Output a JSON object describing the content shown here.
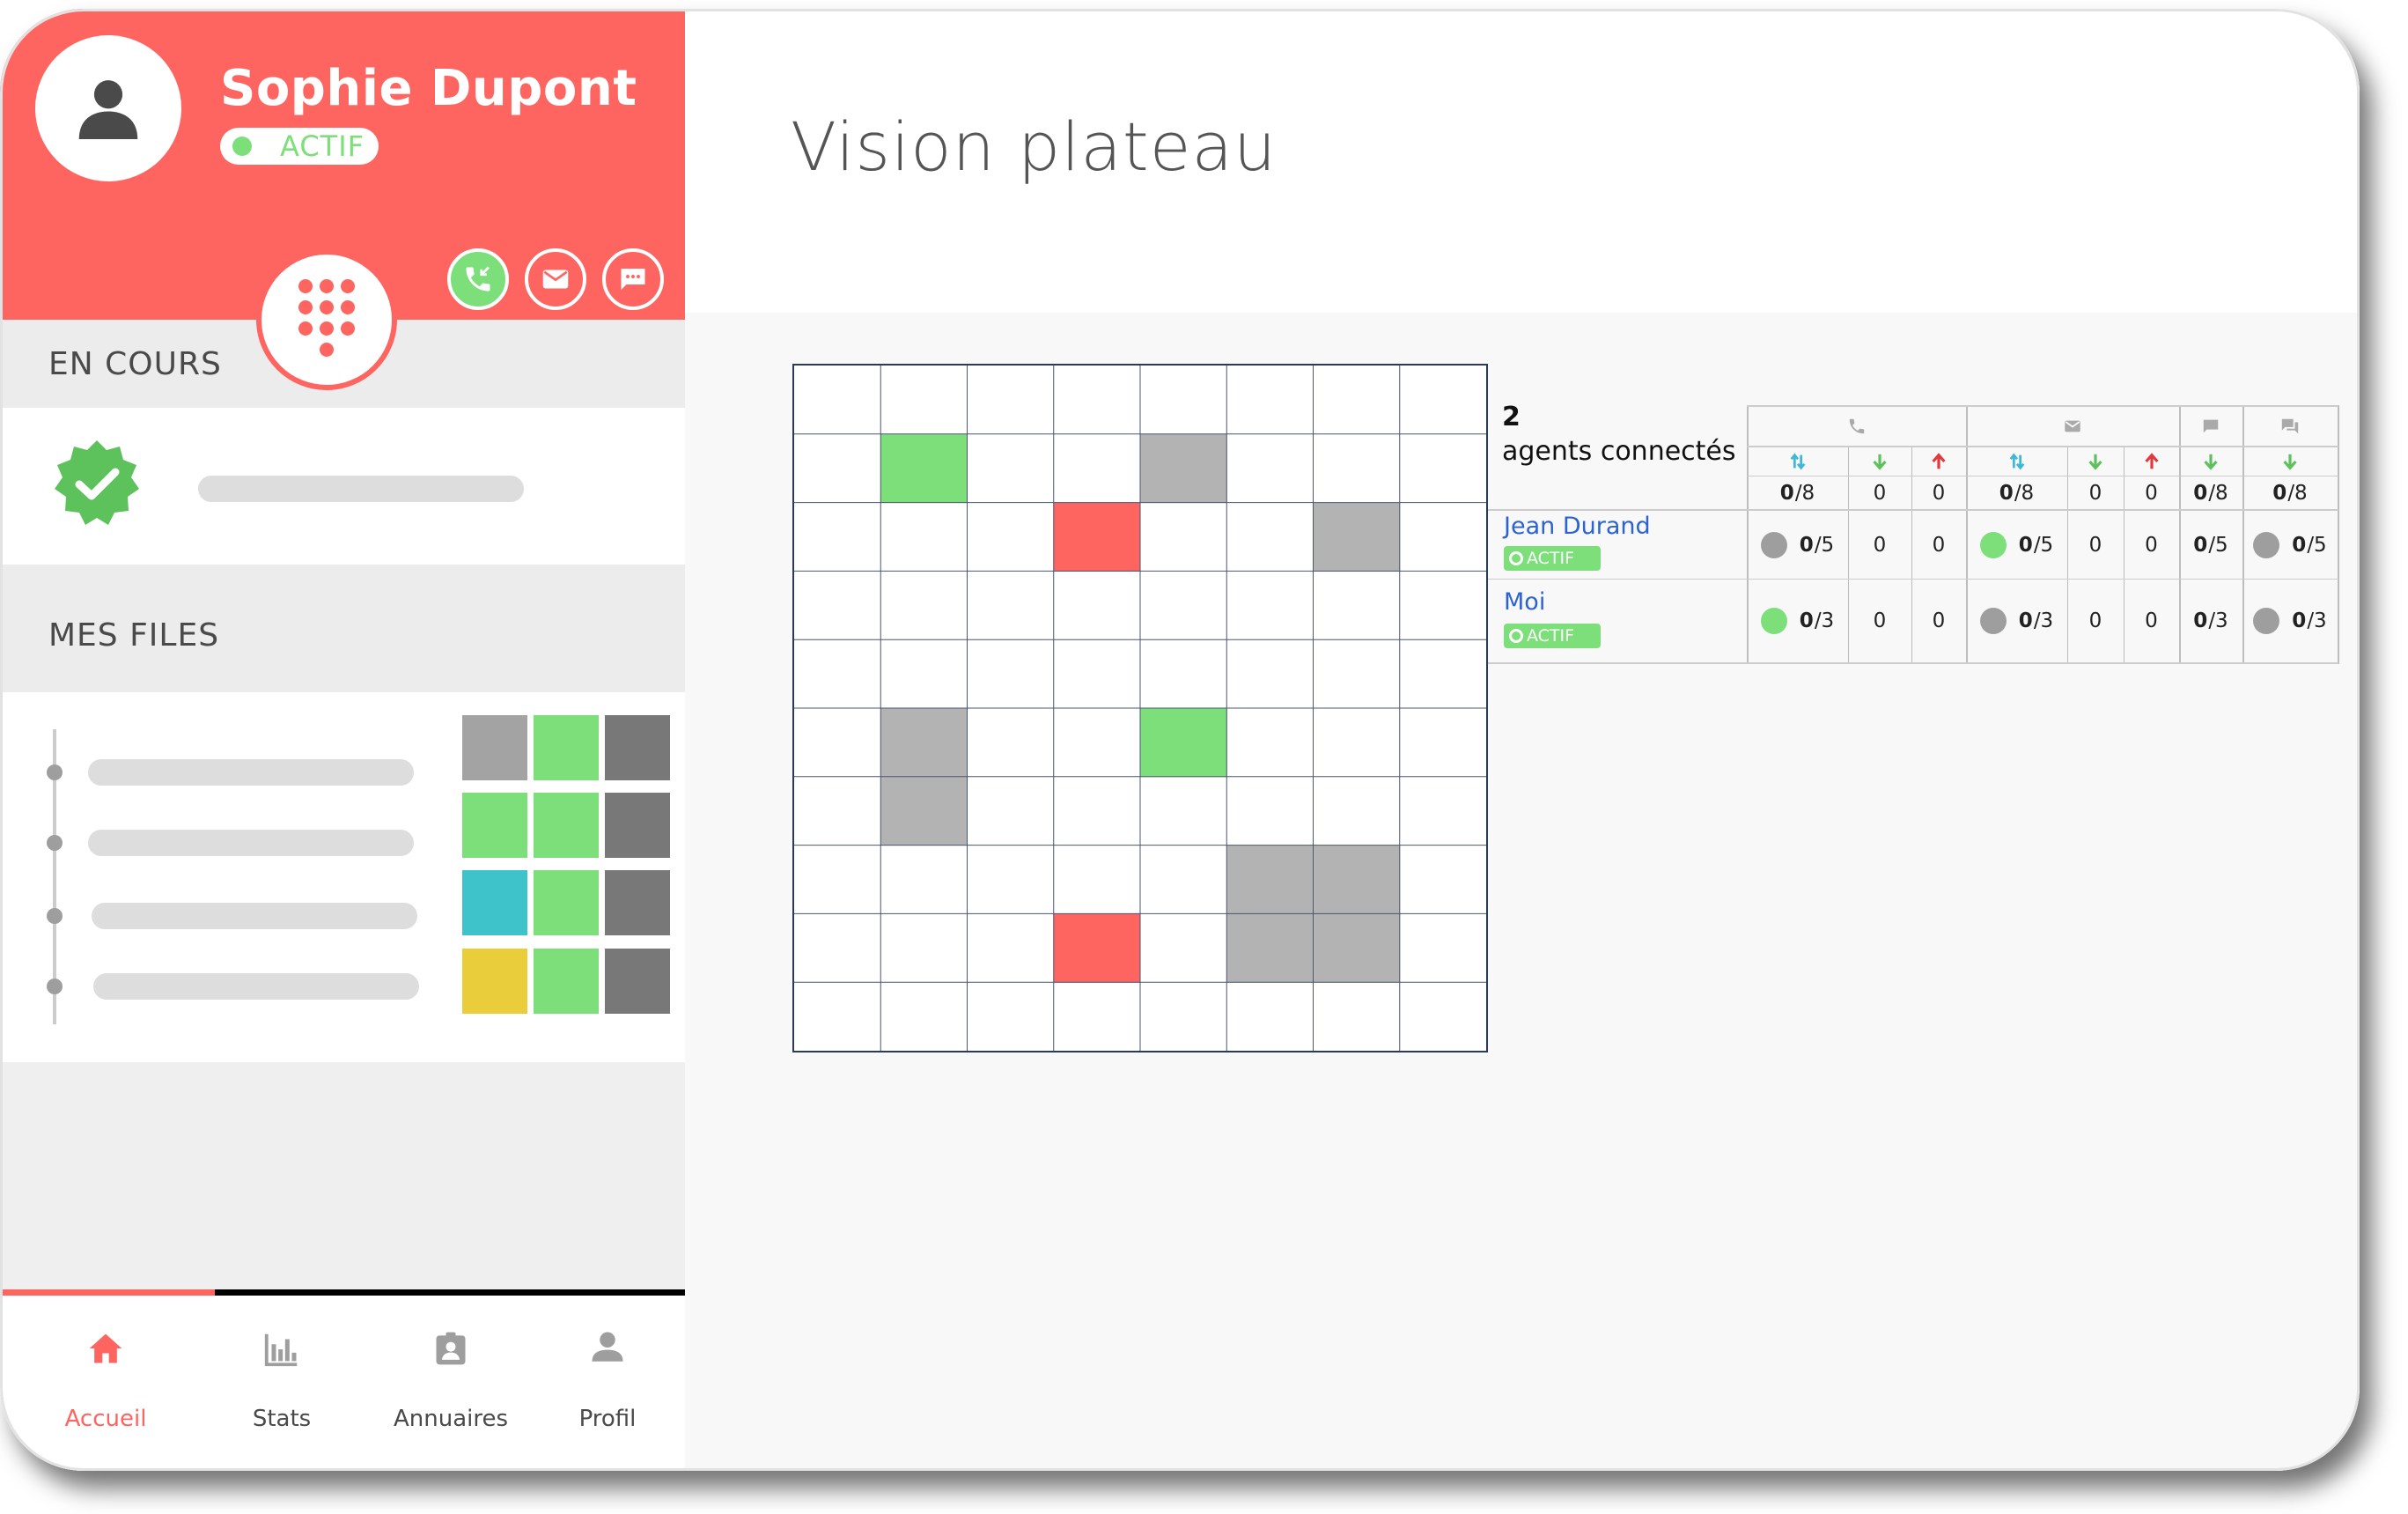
{
  "agent": {
    "name": "Sophie Dupont",
    "status": "ACTIF"
  },
  "sections": {
    "en_cours": "EN COURS",
    "mes_files": "MES FILES"
  },
  "files_tiles": [
    [
      "#a3a3a3",
      "#7cdf7a",
      "#787878"
    ],
    [
      "#7cdf7a",
      "#7cdf7a",
      "#787878"
    ],
    [
      "#3fc3cb",
      "#7cdf7a",
      "#787878"
    ],
    [
      "#eacd3a",
      "#7cdf7a",
      "#787878"
    ]
  ],
  "tabs": [
    {
      "label": "Accueil",
      "icon": "home-icon",
      "active": true
    },
    {
      "label": "Stats",
      "icon": "bar-chart-icon",
      "active": false
    },
    {
      "label": "Annuaires",
      "icon": "contact-book-icon",
      "active": false
    },
    {
      "label": "Profil",
      "icon": "person-icon",
      "active": false
    }
  ],
  "page_title": "Vision plateau",
  "floor_plan": {
    "columns": 8,
    "rows": 10,
    "cells": [
      {
        "row": 1,
        "col": 1,
        "color": "#7cdf7a"
      },
      {
        "row": 1,
        "col": 4,
        "color": "#b3b3b3"
      },
      {
        "row": 2,
        "col": 3,
        "color": "#fe6561"
      },
      {
        "row": 2,
        "col": 6,
        "color": "#b3b3b3"
      },
      {
        "row": 5,
        "col": 1,
        "color": "#b3b3b3"
      },
      {
        "row": 6,
        "col": 1,
        "color": "#b3b3b3"
      },
      {
        "row": 5,
        "col": 4,
        "color": "#7cdf7a"
      },
      {
        "row": 7,
        "col": 5,
        "color": "#b3b3b3"
      },
      {
        "row": 7,
        "col": 6,
        "color": "#b3b3b3"
      },
      {
        "row": 8,
        "col": 5,
        "color": "#b3b3b3"
      },
      {
        "row": 8,
        "col": 6,
        "color": "#b3b3b3"
      },
      {
        "row": 8,
        "col": 3,
        "color": "#fe6561"
      }
    ]
  },
  "supervision": {
    "count": "2",
    "caption": "agents connectés",
    "channel_icons": [
      "phone-icon",
      "mail-icon",
      "chat-icon",
      "forum-icon"
    ],
    "totals": {
      "phone_io": {
        "value": "0",
        "max": "/8"
      },
      "phone_in": "0",
      "phone_out": "0",
      "mail_io": {
        "value": "0",
        "max": "/8"
      },
      "mail_in": "0",
      "mail_out": "0",
      "chat": {
        "value": "0",
        "max": "/8"
      },
      "forum": {
        "value": "0",
        "max": "/8"
      }
    },
    "agents": [
      {
        "name": "Jean Durand",
        "status": "ACTIF",
        "phone": {
          "value": "0",
          "max": "/5",
          "dot": "#9e9e9e"
        },
        "phone_in": "0",
        "phone_out": "0",
        "mail": {
          "value": "0",
          "max": "/5",
          "dot": "#7cdf7a"
        },
        "mail_in": "0",
        "mail_out": "0",
        "chat": {
          "value": "0",
          "max": "/5"
        },
        "forum": {
          "value": "0",
          "max": "/5",
          "dot": "#9e9e9e"
        }
      },
      {
        "name": "Moi",
        "status": "ACTIF",
        "phone": {
          "value": "0",
          "max": "/3",
          "dot": "#7cdf7a"
        },
        "phone_in": "0",
        "phone_out": "0",
        "mail": {
          "value": "0",
          "max": "/3",
          "dot": "#9e9e9e"
        },
        "mail_in": "0",
        "mail_out": "0",
        "chat": {
          "value": "0",
          "max": "/3"
        },
        "forum": {
          "value": "0",
          "max": "/3",
          "dot": "#9e9e9e"
        }
      }
    ]
  }
}
